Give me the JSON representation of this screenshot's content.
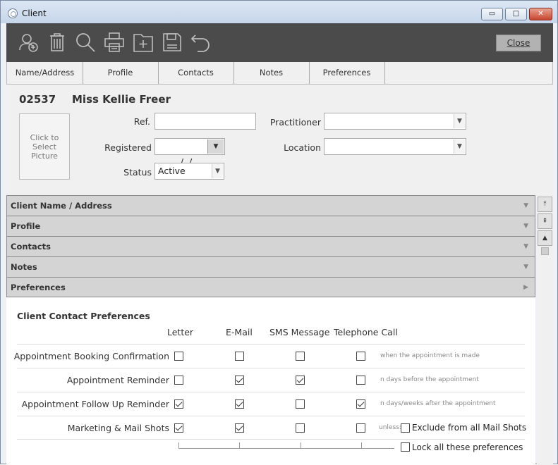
{
  "window": {
    "title": "Client",
    "controls": {
      "minimize": "▭",
      "maximize": "□",
      "close": "✕"
    }
  },
  "toolbar": {
    "icons": [
      "add-client-icon",
      "delete-icon",
      "search-icon",
      "print-icon",
      "new-folder-icon",
      "save-icon",
      "undo-icon"
    ],
    "close_label": "Close"
  },
  "tabs": [
    "Name/Address",
    "Profile",
    "Contacts",
    "Notes",
    "Preferences"
  ],
  "client": {
    "id": "02537",
    "name": "Miss Kellie Freer",
    "picture_prompt": "Click to Select Picture"
  },
  "fields": {
    "ref_label": "Ref.",
    "ref_value": "",
    "registered_label": "Registered",
    "registered_value": "  /  /",
    "status_label": "Status",
    "status_value": "Active",
    "practitioner_label": "Practitioner",
    "practitioner_value": "",
    "location_label": "Location",
    "location_value": ""
  },
  "sections": [
    "Client Name / Address",
    "Profile",
    "Contacts",
    "Notes",
    "Preferences"
  ],
  "scroll_buttons": [
    "⤒",
    "⇞",
    "▲"
  ],
  "preferences": {
    "title": "Client Contact Preferences",
    "columns": [
      "Letter",
      "E-Mail",
      "SMS Message",
      "Telephone Call"
    ],
    "rows": [
      {
        "label": "Appointment Booking Confirmation",
        "checks": [
          false,
          false,
          false,
          false
        ],
        "hint": "when the appointment is made"
      },
      {
        "label": "Appointment Reminder",
        "checks": [
          false,
          true,
          true,
          false
        ],
        "hint": "n days before the appointment"
      },
      {
        "label": "Appointment Follow Up Reminder",
        "checks": [
          true,
          true,
          false,
          true
        ],
        "hint": "n days/weeks after the appointment"
      },
      {
        "label": "Marketing & Mail Shots",
        "checks": [
          true,
          true,
          false,
          false
        ],
        "hint": ""
      }
    ],
    "unless_label": "unless:",
    "exclude_label": "Exclude from all Mail Shots",
    "exclude_checked": false,
    "lock_label": "Lock all these preferences",
    "lock_checked": false
  }
}
